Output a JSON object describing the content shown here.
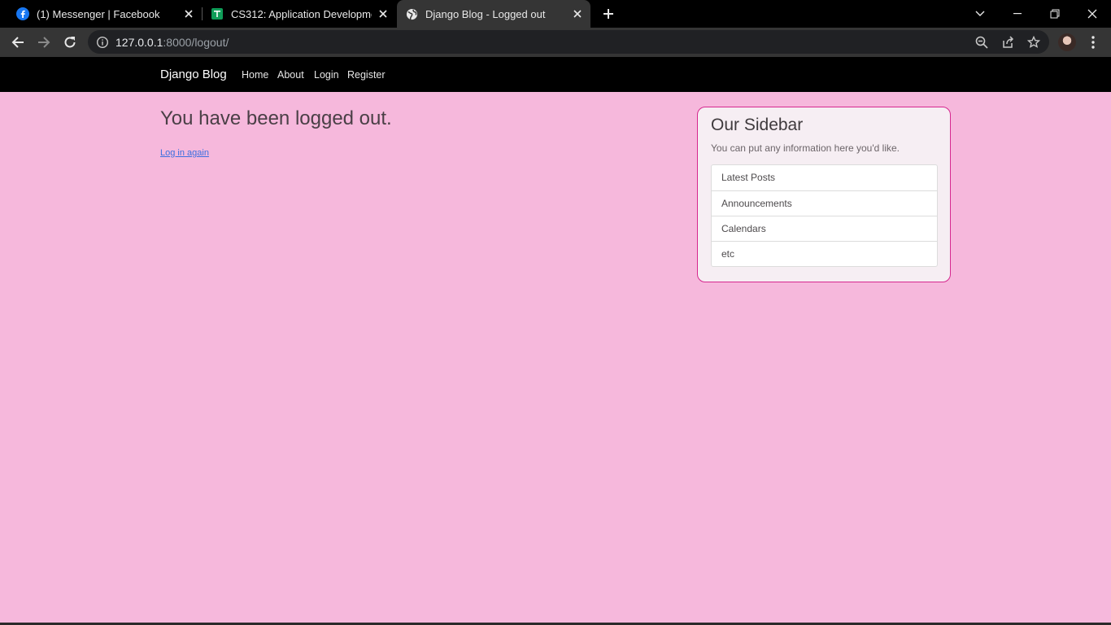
{
  "browser": {
    "tabs": [
      {
        "title": "(1) Messenger | Facebook",
        "icon": "facebook-icon"
      },
      {
        "title": "CS312: Application Development",
        "icon": "google-classroom-icon"
      },
      {
        "title": "Django Blog - Logged out",
        "icon": "globe-icon",
        "active": true
      }
    ],
    "url": {
      "host": "127.0.0.1",
      "rest": ":8000/logout/"
    }
  },
  "site": {
    "brand": "Django Blog",
    "nav": [
      "Home",
      "About",
      "Login",
      "Register"
    ]
  },
  "main": {
    "heading": "You have been logged out.",
    "login_again": "Log in again"
  },
  "sidebar": {
    "title": "Our Sidebar",
    "subtitle": "You can put any information here you'd like.",
    "items": [
      "Latest Posts",
      "Announcements",
      "Calendars",
      "etc"
    ]
  },
  "colors": {
    "page_bg": "#f6b8dc",
    "sidebar_border": "#d6278f",
    "link": "#3b6fe0"
  }
}
